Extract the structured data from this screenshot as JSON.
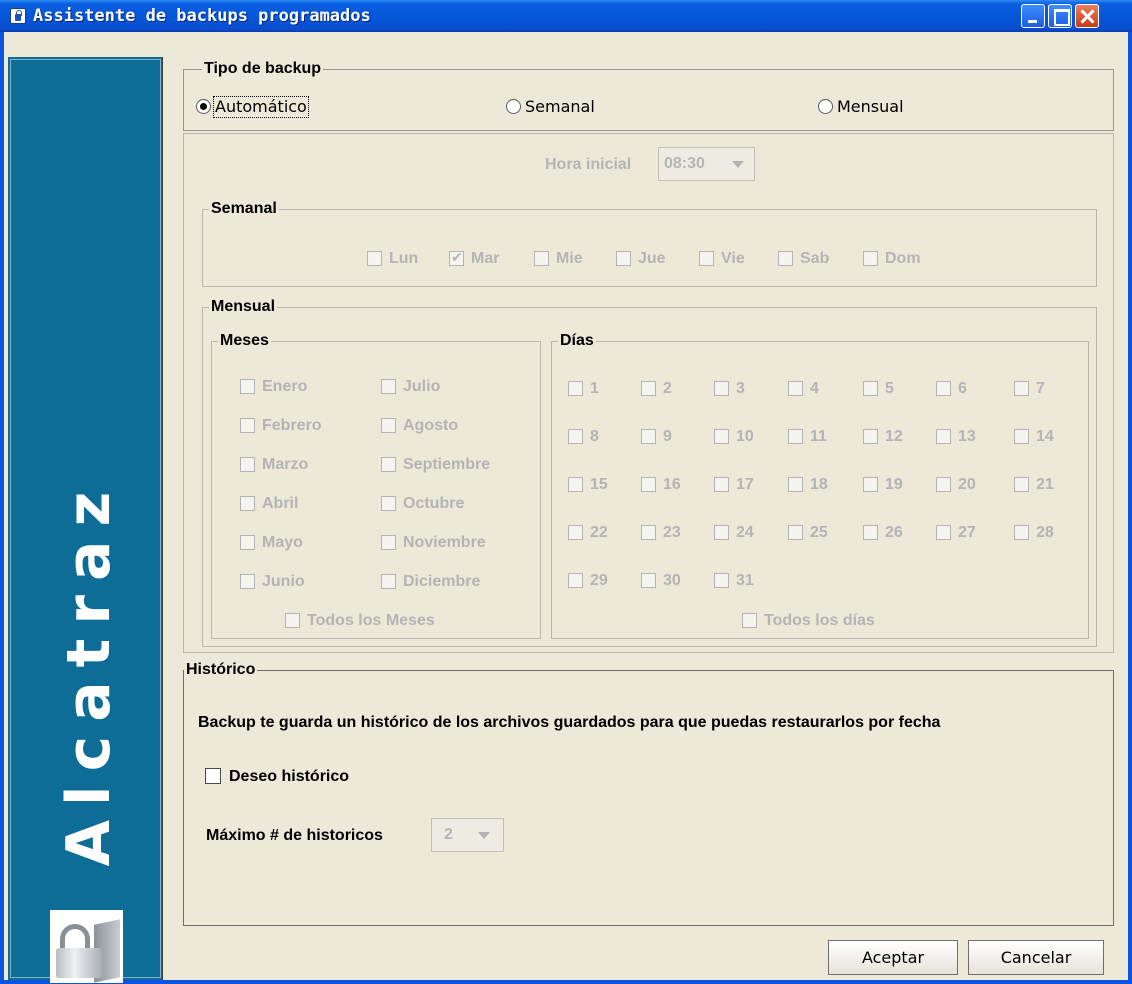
{
  "window": {
    "title": "Assistente de backups programados",
    "controls": [
      "minimize-icon",
      "maximize-icon",
      "close-icon"
    ],
    "accent": "#0a5fe0"
  },
  "brand": {
    "text": "Alcatraz",
    "color": "#0d6d97",
    "logo": "padlock-icon"
  },
  "tipo_backup": {
    "title": "Tipo de backup",
    "options": [
      {
        "label": "Automático",
        "selected": true
      },
      {
        "label": "Semanal",
        "selected": false
      },
      {
        "label": "Mensual",
        "selected": false
      }
    ]
  },
  "hora_inicial": {
    "label": "Hora inicial",
    "value": "08:30"
  },
  "semanal": {
    "title": "Semanal",
    "days": [
      {
        "label": "Lun",
        "checked": false
      },
      {
        "label": "Mar",
        "checked": true
      },
      {
        "label": "Mie",
        "checked": false
      },
      {
        "label": "Jue",
        "checked": false
      },
      {
        "label": "Vie",
        "checked": false
      },
      {
        "label": "Sab",
        "checked": false
      },
      {
        "label": "Dom",
        "checked": false
      }
    ]
  },
  "mensual": {
    "title": "Mensual",
    "meses": {
      "title": "Meses",
      "items": [
        "Enero",
        "Julio",
        "Febrero",
        "Agosto",
        "Marzo",
        "Septiembre",
        "Abril",
        "Octubre",
        "Mayo",
        "Noviembre",
        "Junio",
        "Diciembre"
      ],
      "all_label": "Todos los Meses"
    },
    "dias": {
      "title": "Días",
      "items": [
        "1",
        "2",
        "3",
        "4",
        "5",
        "6",
        "7",
        "8",
        "9",
        "10",
        "11",
        "12",
        "13",
        "14",
        "15",
        "16",
        "17",
        "18",
        "19",
        "20",
        "21",
        "22",
        "23",
        "24",
        "25",
        "26",
        "27",
        "28",
        "29",
        "30",
        "31"
      ],
      "all_label": "Todos los días"
    }
  },
  "historico": {
    "title": "Histórico",
    "description": "Backup te guarda un histórico de los archivos guardados para que puedas restaurarlos por fecha",
    "checkbox_label": "Deseo histórico",
    "checkbox_checked": false,
    "max_label": "Máximo # de historicos",
    "max_value": "2"
  },
  "buttons": {
    "accept": "Aceptar",
    "cancel": "Cancelar"
  }
}
